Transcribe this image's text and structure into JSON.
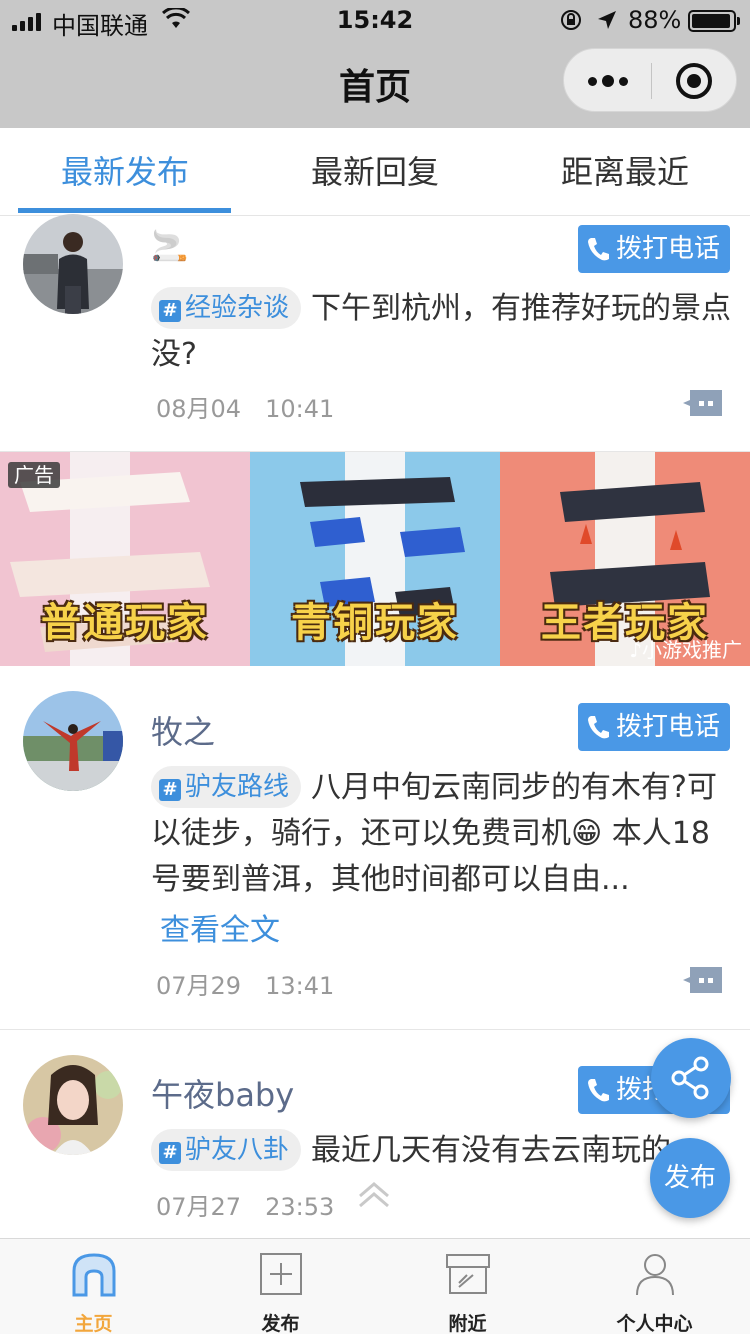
{
  "status_bar": {
    "carrier": "中国联通",
    "time": "15:42",
    "battery": "88%"
  },
  "nav": {
    "title": "首页"
  },
  "tabs": [
    {
      "label": "最新发布",
      "active": true
    },
    {
      "label": "最新回复",
      "active": false
    },
    {
      "label": "距离最近",
      "active": false
    }
  ],
  "posts": [
    {
      "username_emoji": "🚬",
      "call_label": "拨打电话",
      "tag": "经验杂谈",
      "text": "下午到杭州，有推荐好玩的景点没?",
      "date": "08月04",
      "time": "10:41"
    },
    {
      "username": "牧之",
      "call_label": "拨打电话",
      "tag": "驴友路线",
      "text": "八月中旬云南同步的有木有?可以徒步，骑行，还可以免费司机😁 本人18号要到普洱，其他时间都可以自由...",
      "read_more": "查看全文",
      "date": "07月29",
      "time": "13:41"
    },
    {
      "username": "午夜baby",
      "call_label": "拨打电话",
      "tag": "驴友八卦",
      "text": "最近几天有没有去云南玩的",
      "date": "07月27",
      "time": "23:53"
    }
  ],
  "ad": {
    "label": "广告",
    "panels": [
      "普通玩家",
      "青铜玩家",
      "王者玩家"
    ],
    "source": "小游戏推广"
  },
  "fab": {
    "publish": "发布"
  },
  "tabbar": [
    {
      "label": "主页",
      "icon": "home-icon",
      "active": true
    },
    {
      "label": "发布",
      "icon": "plus-square-icon",
      "active": false
    },
    {
      "label": "附近",
      "icon": "nearby-box-icon",
      "active": false
    },
    {
      "label": "个人中心",
      "icon": "person-icon",
      "active": false
    }
  ],
  "colors": {
    "accent": "#3d8fdc",
    "button": "#4a98e6",
    "active_tab": "#f2a63c",
    "nav_bg": "#c8c8c8"
  }
}
